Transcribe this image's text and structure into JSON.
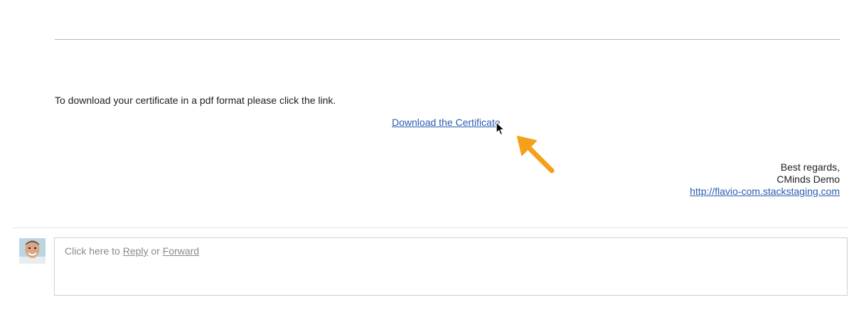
{
  "message": {
    "body_text": "To download your certificate in a pdf format please click the link.",
    "download_link_label": "Download the Certificate"
  },
  "signature": {
    "closing": "Best regards,",
    "sender": "CMinds Demo",
    "website": "http://flavio-com.stackstaging.com"
  },
  "reply": {
    "prompt_prefix": "Click here to ",
    "reply_label": "Reply",
    "or_text": " or ",
    "forward_label": "Forward"
  },
  "icons": {
    "cursor": "mouse-pointer-icon",
    "annotation": "orange-arrow-icon",
    "avatar": "user-avatar"
  },
  "colors": {
    "link": "#2a5db0",
    "annotation_arrow": "#f5a01a",
    "reply_prompt": "#8a8a8a"
  }
}
